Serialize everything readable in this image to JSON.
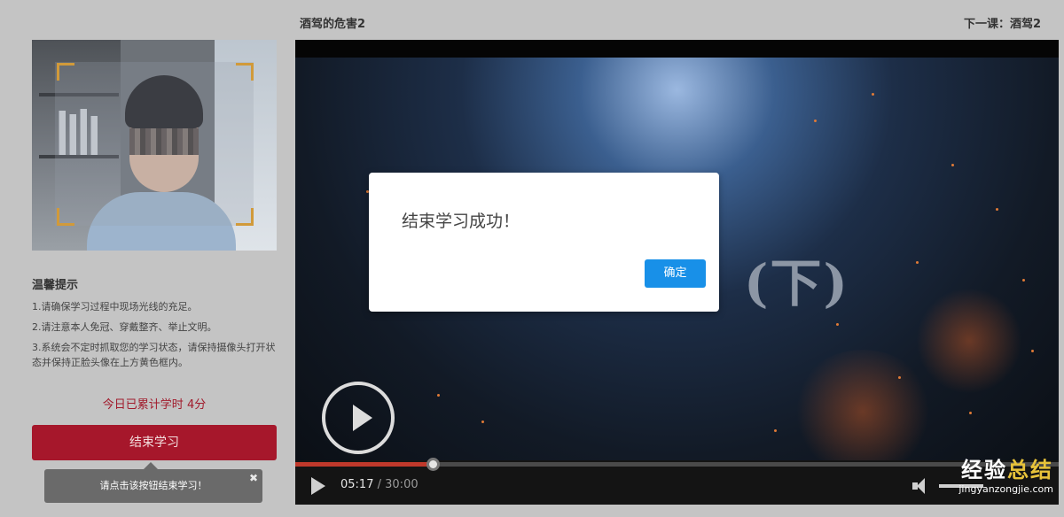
{
  "header": {
    "lesson_title": "酒驾的危害2",
    "next_lesson": "下一课：酒驾2"
  },
  "tips": {
    "title": "温馨提示",
    "items": [
      "1.请确保学习过程中现场光线的充足。",
      "2.请注意本人免冠、穿戴整齐、举止文明。",
      "3.系统会不定时抓取您的学习状态，请保持摄像头打开状态并保持正脸头像在上方黄色框内。"
    ]
  },
  "study": {
    "today_label": "今日已累计学时",
    "today_value": "4分",
    "end_button": "结束学习",
    "tooltip": "请点击该按钮结束学习！",
    "tooltip_close": "✖"
  },
  "video": {
    "frame_text": "(下)",
    "current_time": "05:17",
    "separator": "/",
    "total_time": "30:00",
    "progress": 0.18
  },
  "dialog": {
    "message": "结束学习成功！",
    "ok_label": "确定"
  },
  "watermark": {
    "logo_part1": "经验",
    "logo_part2": "总结",
    "url": "jingyanzongjie.com"
  },
  "colors": {
    "accent_red": "#a6172b",
    "primary_blue": "#1890e8",
    "camera_frame": "#d19a3a"
  }
}
